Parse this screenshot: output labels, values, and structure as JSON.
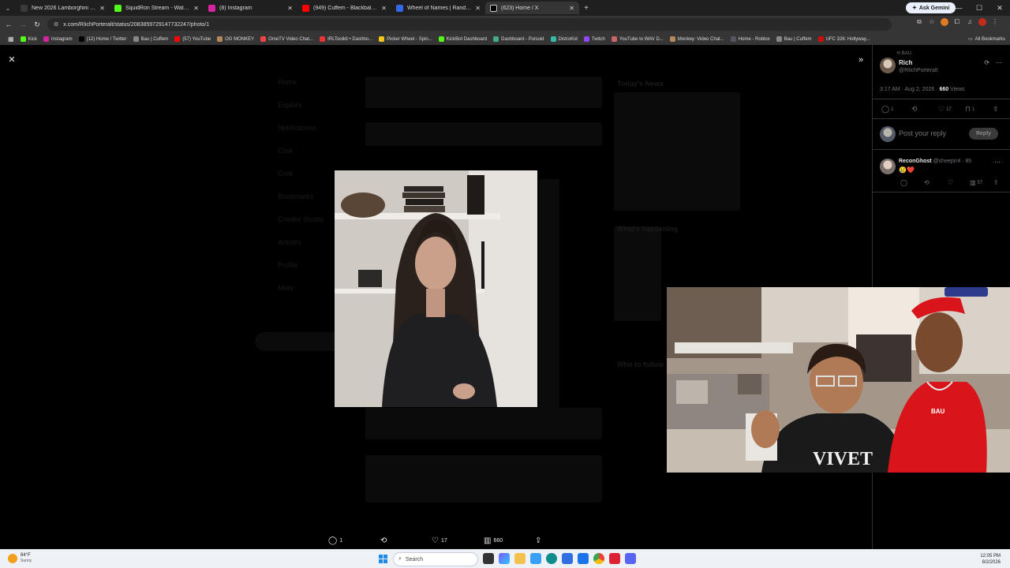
{
  "browser": {
    "tabs": [
      {
        "title": "New 2026 Lamborghini Urus S",
        "color": "#3a3a3a",
        "active": false
      },
      {
        "title": "SquidRon Stream - Watch Live",
        "color": "#53fc18",
        "active": false
      },
      {
        "title": "(8) Instagram",
        "color": "#d6249f",
        "active": false
      },
      {
        "title": "(949) Cuffem - Blackballed (Sh",
        "color": "#ff0000",
        "active": false
      },
      {
        "title": "Wheel of Names | Random nam",
        "color": "#3369e8",
        "active": false
      },
      {
        "title": "(623) Home / X",
        "color": "#000000",
        "active": true
      }
    ],
    "gemini_label": "Ask Gemini",
    "url": "x.com/RIichPorteralt/status/2083859729147732247/photo/1",
    "bookmarks": [
      {
        "label": "Kick",
        "color": "#53fc18"
      },
      {
        "label": "Instagram",
        "color": "#d6249f"
      },
      {
        "label": "(12) Home / Twitter",
        "color": "#000000"
      },
      {
        "label": "Bau | Cuffem",
        "color": "#888888"
      },
      {
        "label": "(57) YouTube",
        "color": "#ff0000"
      },
      {
        "label": "OG MONKEY",
        "color": "#b5895c"
      },
      {
        "label": "OmeTV Video Chat...",
        "color": "#e44"
      },
      {
        "label": "IRLToolkit • Dashbo...",
        "color": "#e33"
      },
      {
        "label": "Picker Wheel - Spin...",
        "color": "#f5c518"
      },
      {
        "label": "KickBot Dashboard",
        "color": "#53fc18"
      },
      {
        "label": "Dashboard - Pulsoid",
        "color": "#4a8"
      },
      {
        "label": "DistroKid",
        "color": "#3ba"
      },
      {
        "label": "Twitch",
        "color": "#9146ff"
      },
      {
        "label": "YouTube to WAV D...",
        "color": "#c66"
      },
      {
        "label": "Monkey: Video Chat...",
        "color": "#b5895c"
      },
      {
        "label": "Home - Roblox",
        "color": "#556"
      },
      {
        "label": "Bau | Cuffem",
        "color": "#888888"
      },
      {
        "label": "UFC 326: Hollyway...",
        "color": "#d20a0a"
      }
    ],
    "all_bookmarks": "All Bookmarks"
  },
  "background_feed": {
    "nav": [
      "Home",
      "Explore",
      "Notifications",
      "Chat",
      "Grok",
      "Bookmarks",
      "Creator Studio",
      "Articles",
      "Profile",
      "More"
    ],
    "right": [
      "Today's News",
      "What's happening",
      "Who to follow"
    ]
  },
  "action_bar": {
    "replies": "1",
    "likes": "17",
    "views": "660"
  },
  "tweet": {
    "repost_label": "BAU",
    "name": "Rich",
    "handle": "@RIichPorteralt",
    "time": "3:17 AM · Aug 2, 2026 · ",
    "views_count": "660",
    "views_label": " Views",
    "stats": {
      "replies": "1",
      "reposts": "",
      "likes": "17",
      "bookmarks": "1"
    }
  },
  "reply_box": {
    "placeholder": "Post your reply",
    "button": "Reply"
  },
  "comment": {
    "name": "ReconGhost",
    "handle": "@sheeprr4 · 8h",
    "text": "😢❤️",
    "views": "57"
  },
  "taskbar": {
    "temp": "84°F",
    "condition": "Sunny",
    "search": "Search",
    "time": "12:05 PM",
    "date": "8/2/2026"
  }
}
